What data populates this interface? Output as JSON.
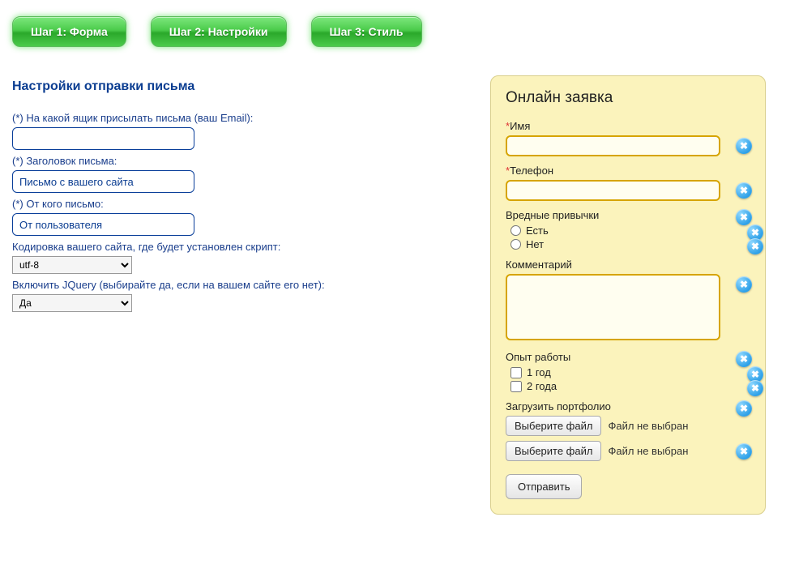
{
  "steps": {
    "s1": "Шаг 1: Форма",
    "s2": "Шаг 2: Настройки",
    "s3": "Шаг 3: Стиль"
  },
  "settings": {
    "title": "Настройки отправки письма",
    "email_label": "(*) На какой ящик присылать письма (ваш Email):",
    "email_value": "",
    "subject_label": "(*) Заголовок письма:",
    "subject_value": "Письмо с вашего сайта",
    "from_label": "(*) От кого письмо:",
    "from_value": "От пользователя",
    "encoding_label": "Кодировка вашего сайта, где будет установлен скрипт:",
    "encoding_value": "utf-8",
    "jquery_label": "Включить JQuery (выбирайте да, если на вашем сайте его нет):",
    "jquery_value": "Да"
  },
  "preview": {
    "title": "Онлайн заявка",
    "name_label": "Имя",
    "phone_label": "Телефон",
    "habits_label": "Вредные привычки",
    "habit_yes": "Есть",
    "habit_no": "Нет",
    "comment_label": "Комментарий",
    "exp_label": "Опыт работы",
    "exp_1": "1 год",
    "exp_2": "2 года",
    "upload_label": "Загрузить портфолио",
    "file_btn": "Выберите файл",
    "file_none": "Файл не выбран",
    "submit": "Отправить",
    "delete_glyph": "✖"
  }
}
